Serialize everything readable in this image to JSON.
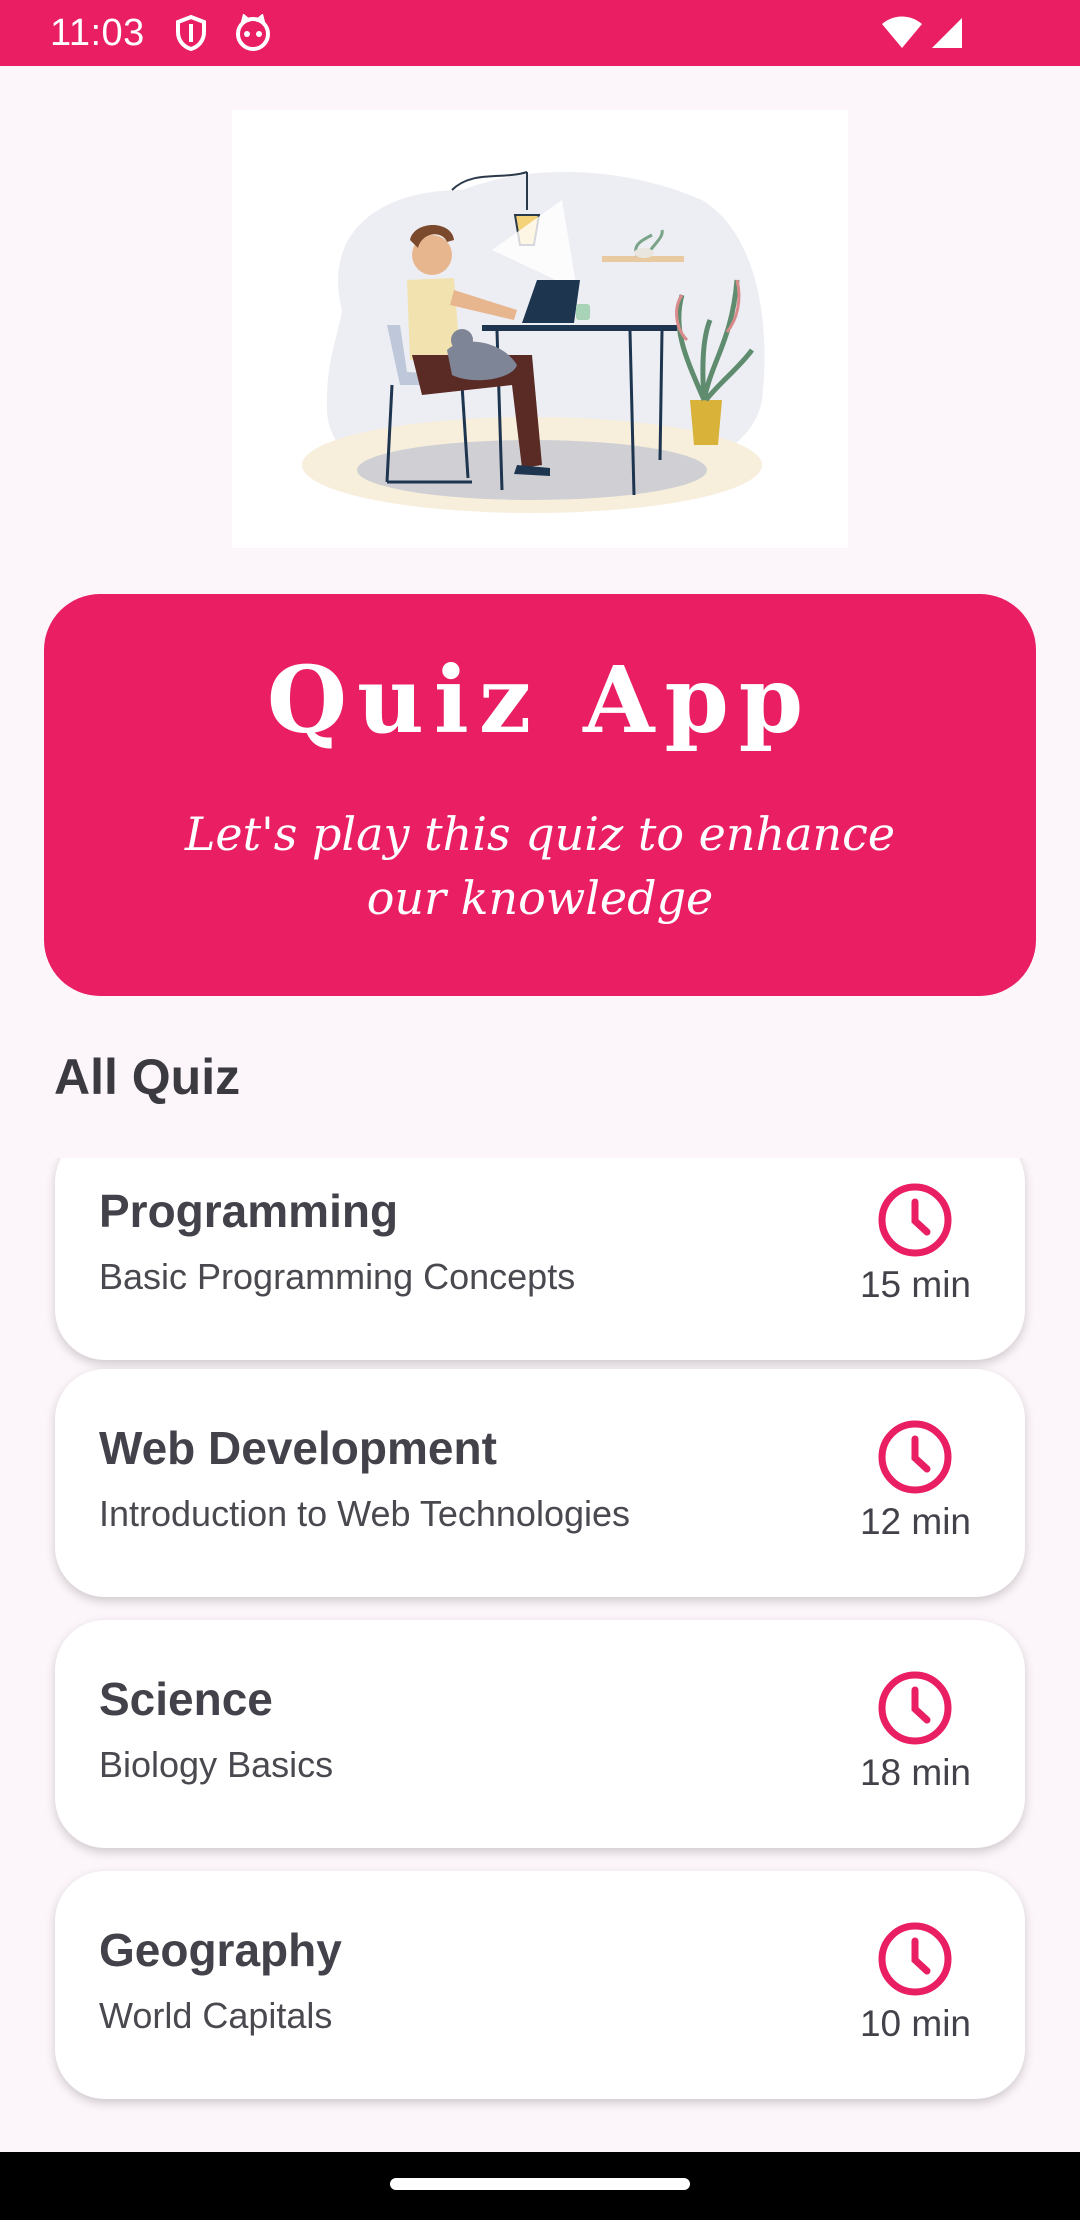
{
  "status_bar": {
    "time": "11:03",
    "color": "#E91E63",
    "left_icons": [
      "shield-icon",
      "cat-face-icon"
    ],
    "right_icons": [
      "wifi-icon",
      "cellular-signal-icon"
    ]
  },
  "hero": {
    "illustration": "person-working-at-laptop-illustration"
  },
  "banner": {
    "title": "Quiz App",
    "subtitle": "Let's play this quiz to enhance our knowledge",
    "color": "#E91E63"
  },
  "section": {
    "title": "All Quiz"
  },
  "quizzes": [
    {
      "title": "Programming",
      "subtitle": "Basic Programming Concepts",
      "duration": "15 min",
      "icon": "clock-icon"
    },
    {
      "title": "Web Development",
      "subtitle": "Introduction to Web Technologies",
      "duration": "12 min",
      "icon": "clock-icon"
    },
    {
      "title": "Science",
      "subtitle": "Biology Basics",
      "duration": "18 min",
      "icon": "clock-icon"
    },
    {
      "title": "Geography",
      "subtitle": "World Capitals",
      "duration": "10 min",
      "icon": "clock-icon"
    }
  ],
  "accent_color": "#E91E63"
}
